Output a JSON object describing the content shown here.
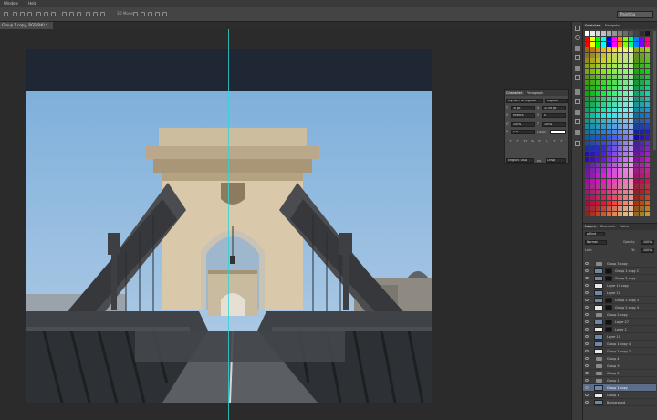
{
  "menu": [
    "Window",
    "Help"
  ],
  "options_bar": {
    "zoom_label": "3D Mode:",
    "workspace": "Painting"
  },
  "document": {
    "tab_title": "Group 1 copy, RGB/8#) *"
  },
  "character_panel": {
    "tabs": [
      "Character",
      "Paragraph"
    ],
    "font_family": "Myriad Pro Regular",
    "font_style": "Regular",
    "font_size": "30 pt",
    "leading": "35.59 pt",
    "kerning": "Metrics",
    "tracking": "0",
    "vertical_scale": "100%",
    "horizontal_scale": "100%",
    "baseline_shift": "0 pt",
    "color_label": "Color:",
    "language": "English: USA",
    "antialias": "Crisp",
    "type_buttons": [
      "T",
      "T",
      "TT",
      "Tr",
      "T'",
      "T,",
      "T",
      "T"
    ]
  },
  "swatches_panel": {
    "tabs": [
      "Swatches",
      "Navigator"
    ]
  },
  "layers_panel": {
    "tabs": [
      "Layers",
      "Channels",
      "Paths"
    ],
    "filter_label": "ρ Kind",
    "blend_mode": "Normal",
    "opacity_label": "Opacity:",
    "opacity": "100%",
    "lock_label": "Lock:",
    "fill_label": "Fill:",
    "fill": "100%",
    "layers": [
      {
        "name": "Group 3 copy",
        "kind": "group"
      },
      {
        "name": "Group 2 copy 2",
        "kind": "layer-mask"
      },
      {
        "name": "Group 2 copy",
        "kind": "layer-mask"
      },
      {
        "name": "Layer 10 copy",
        "kind": "layer"
      },
      {
        "name": "Layer 10",
        "kind": "layer"
      },
      {
        "name": "Group 2 copy 3",
        "kind": "layer-mask"
      },
      {
        "name": "Group 2 copy 4",
        "kind": "layer-mask"
      },
      {
        "name": "Group 2 copy",
        "kind": "group"
      },
      {
        "name": "Layer 27",
        "kind": "layer-mask"
      },
      {
        "name": "Layer 2",
        "kind": "layer-mask"
      },
      {
        "name": "Layer 10",
        "kind": "layer"
      },
      {
        "name": "Group 1 copy 4",
        "kind": "layer"
      },
      {
        "name": "Group 1 copy 2",
        "kind": "layer"
      },
      {
        "name": "Group 4",
        "kind": "group"
      },
      {
        "name": "Group 3",
        "kind": "group"
      },
      {
        "name": "Group 2",
        "kind": "group"
      },
      {
        "name": "Group 1",
        "kind": "group"
      },
      {
        "name": "Group 1 copy",
        "kind": "layer",
        "selected": true
      },
      {
        "name": "Group 1",
        "kind": "layer"
      },
      {
        "name": "Background",
        "kind": "layer"
      }
    ]
  },
  "colors": {
    "sky": "#8fb8de",
    "stone": "#d8c8aa",
    "bridge_dark": "#3a3d42",
    "guide": "#2fd4d4",
    "selected_layer": "#5c6e8a"
  }
}
